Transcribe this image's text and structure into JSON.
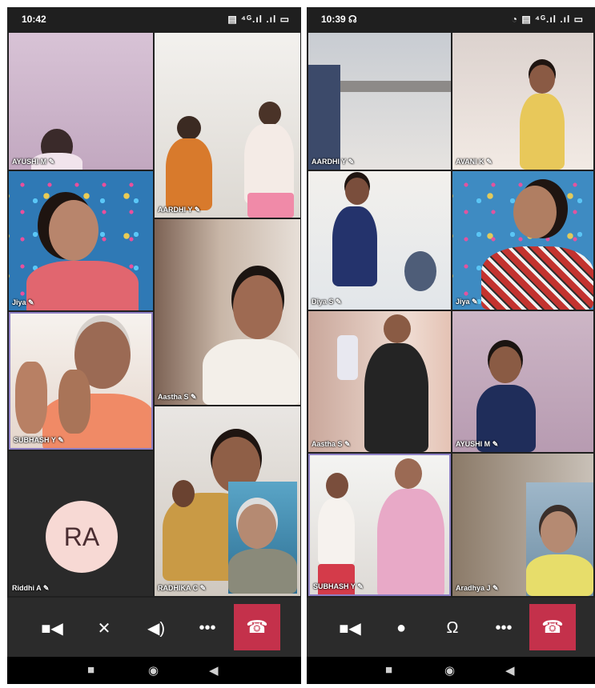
{
  "left_phone": {
    "status": {
      "time": "10:42",
      "icons": "▤ ⁴ᴳ.ıl .ıl ▭"
    },
    "participants": [
      {
        "name": "AYUSHI M"
      },
      {
        "name": "AARDHI Y"
      },
      {
        "name": "Jiya"
      },
      {
        "name": "Aastha S"
      },
      {
        "name": "SUBHASH Y"
      },
      {
        "name": "RADHIKA C"
      },
      {
        "name": "Riddhi A",
        "initials": "RA"
      }
    ]
  },
  "right_phone": {
    "status": {
      "time": "10:39 ☊",
      "icons": "◔ ▤ ⁴ᴳ.ıl .ıl ▭"
    },
    "participants": [
      {
        "name": "AARDHI Y"
      },
      {
        "name": "AVANI K"
      },
      {
        "name": "Diya S"
      },
      {
        "name": "Jiya"
      },
      {
        "name": "Aastha S"
      },
      {
        "name": "AYUSHI M"
      },
      {
        "name": "SUBHASH Y"
      },
      {
        "name": "Aradhya J"
      }
    ]
  },
  "icons": {
    "mic_badge": "✎",
    "video": "■◀",
    "mic_off": "✕",
    "mic": "●",
    "speaker": "◀)",
    "headset": "Ω",
    "more": "•••",
    "end_call": "☎",
    "nav_recent": "■",
    "nav_home": "◉",
    "nav_back": "◀"
  },
  "colors": {
    "end_call": "#c4314b",
    "toolbar": "#2b2b2b",
    "active_speaker_border": "#8d7fc4"
  }
}
